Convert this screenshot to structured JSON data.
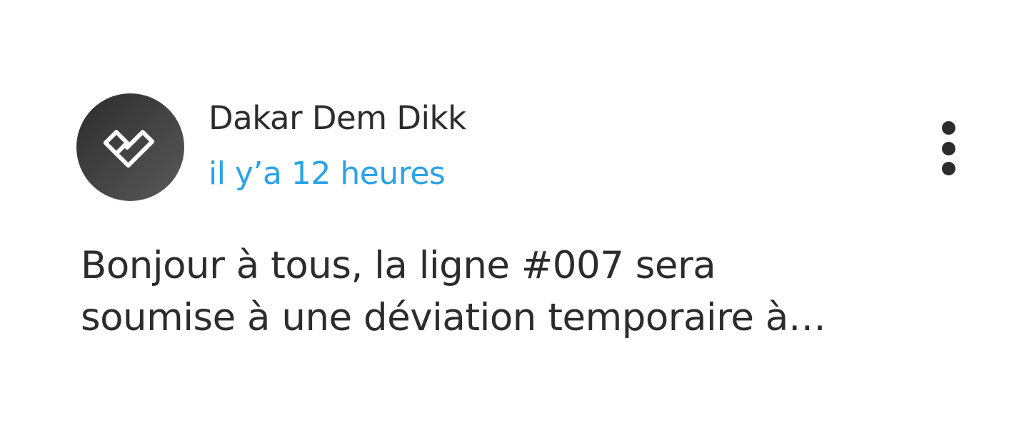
{
  "post": {
    "author": "Dakar Dem Dikk",
    "time_ago": "il y’a 12 heures",
    "message_lines": [
      "Bonjour à tous, la ligne #007 sera",
      "soumise à une déviation temporaire à…"
    ],
    "avatar_icon": "heart-logo-icon",
    "more_icon": "more-vertical-icon"
  },
  "colors": {
    "text": "#2c2c2c",
    "accent": "#2ba3e8",
    "avatar_bg": "#3a3a3a"
  }
}
